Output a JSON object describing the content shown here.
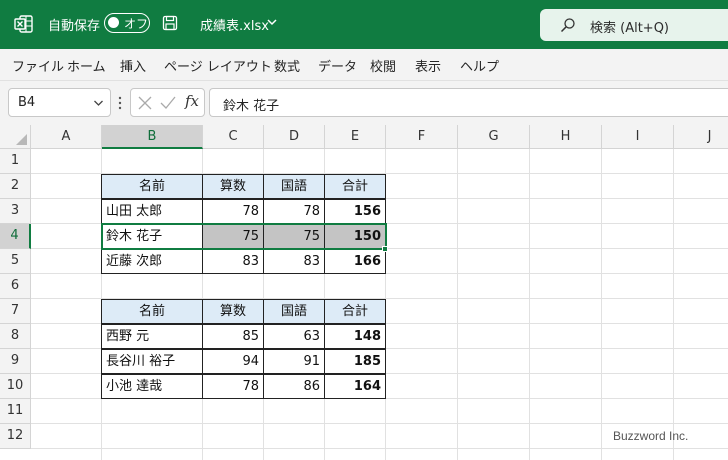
{
  "titlebar": {
    "autosave_label": "自動保存",
    "autosave_state": "オフ",
    "filename": "成績表.xlsx",
    "search_placeholder": "検索 (Alt+Q)",
    "accent_color": "#107c41"
  },
  "menu": [
    "ファイル",
    "ホーム",
    "挿入",
    "ページ レイアウト",
    "数式",
    "データ",
    "校閲",
    "表示",
    "ヘルプ"
  ],
  "formula_bar": {
    "name_box": "B4",
    "fx_label": "fx",
    "formula": "鈴木 花子"
  },
  "sheet": {
    "columns": [
      "A",
      "B",
      "C",
      "D",
      "E",
      "F",
      "G",
      "H",
      "I",
      "J"
    ],
    "rows": [
      "1",
      "2",
      "3",
      "4",
      "5",
      "6",
      "7",
      "8",
      "9",
      "10",
      "11",
      "12"
    ],
    "selected_cell": "B4",
    "selected_row": "4",
    "table1": {
      "headers": [
        "名前",
        "算数",
        "国語",
        "合計"
      ],
      "rows": [
        [
          "山田 太郎",
          "78",
          "78",
          "156"
        ],
        [
          "鈴木 花子",
          "75",
          "75",
          "150"
        ],
        [
          "近藤 次郎",
          "83",
          "83",
          "166"
        ]
      ]
    },
    "table2": {
      "headers": [
        "名前",
        "算数",
        "国語",
        "合計"
      ],
      "rows": [
        [
          "西野 元",
          "85",
          "63",
          "148"
        ],
        [
          "長谷川 裕子",
          "94",
          "91",
          "185"
        ],
        [
          "小池 達哉",
          "78",
          "86",
          "164"
        ]
      ]
    },
    "highlight_color": "#c4c4c4",
    "header_fill": "#ddebf7"
  },
  "watermark": "Buzzword Inc."
}
